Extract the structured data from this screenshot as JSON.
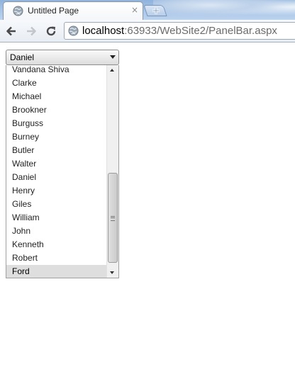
{
  "browser": {
    "tab": {
      "title": "Untitled Page",
      "close_symbol": "×",
      "favicon": "globe-icon"
    },
    "new_tab_icon": "plus-icon",
    "toolbar": {
      "back_icon": "back-arrow-icon",
      "forward_icon": "forward-arrow-icon",
      "reload_icon": "reload-icon"
    },
    "address": {
      "host": "localhost",
      "rest": ":63933/WebSite2/PanelBar.aspx",
      "icon": "globe-icon"
    }
  },
  "dropdown": {
    "selected_value": "Daniel",
    "options": [
      "Vandana Shiva",
      "Clarke",
      "Michael",
      "Brookner",
      "Burguss",
      "Burney",
      "Butler",
      "Walter",
      "Daniel",
      "Henry",
      "Giles",
      "William",
      "John",
      "Kenneth",
      "Robert",
      "Ford"
    ],
    "highlighted_option": "Ford"
  }
}
